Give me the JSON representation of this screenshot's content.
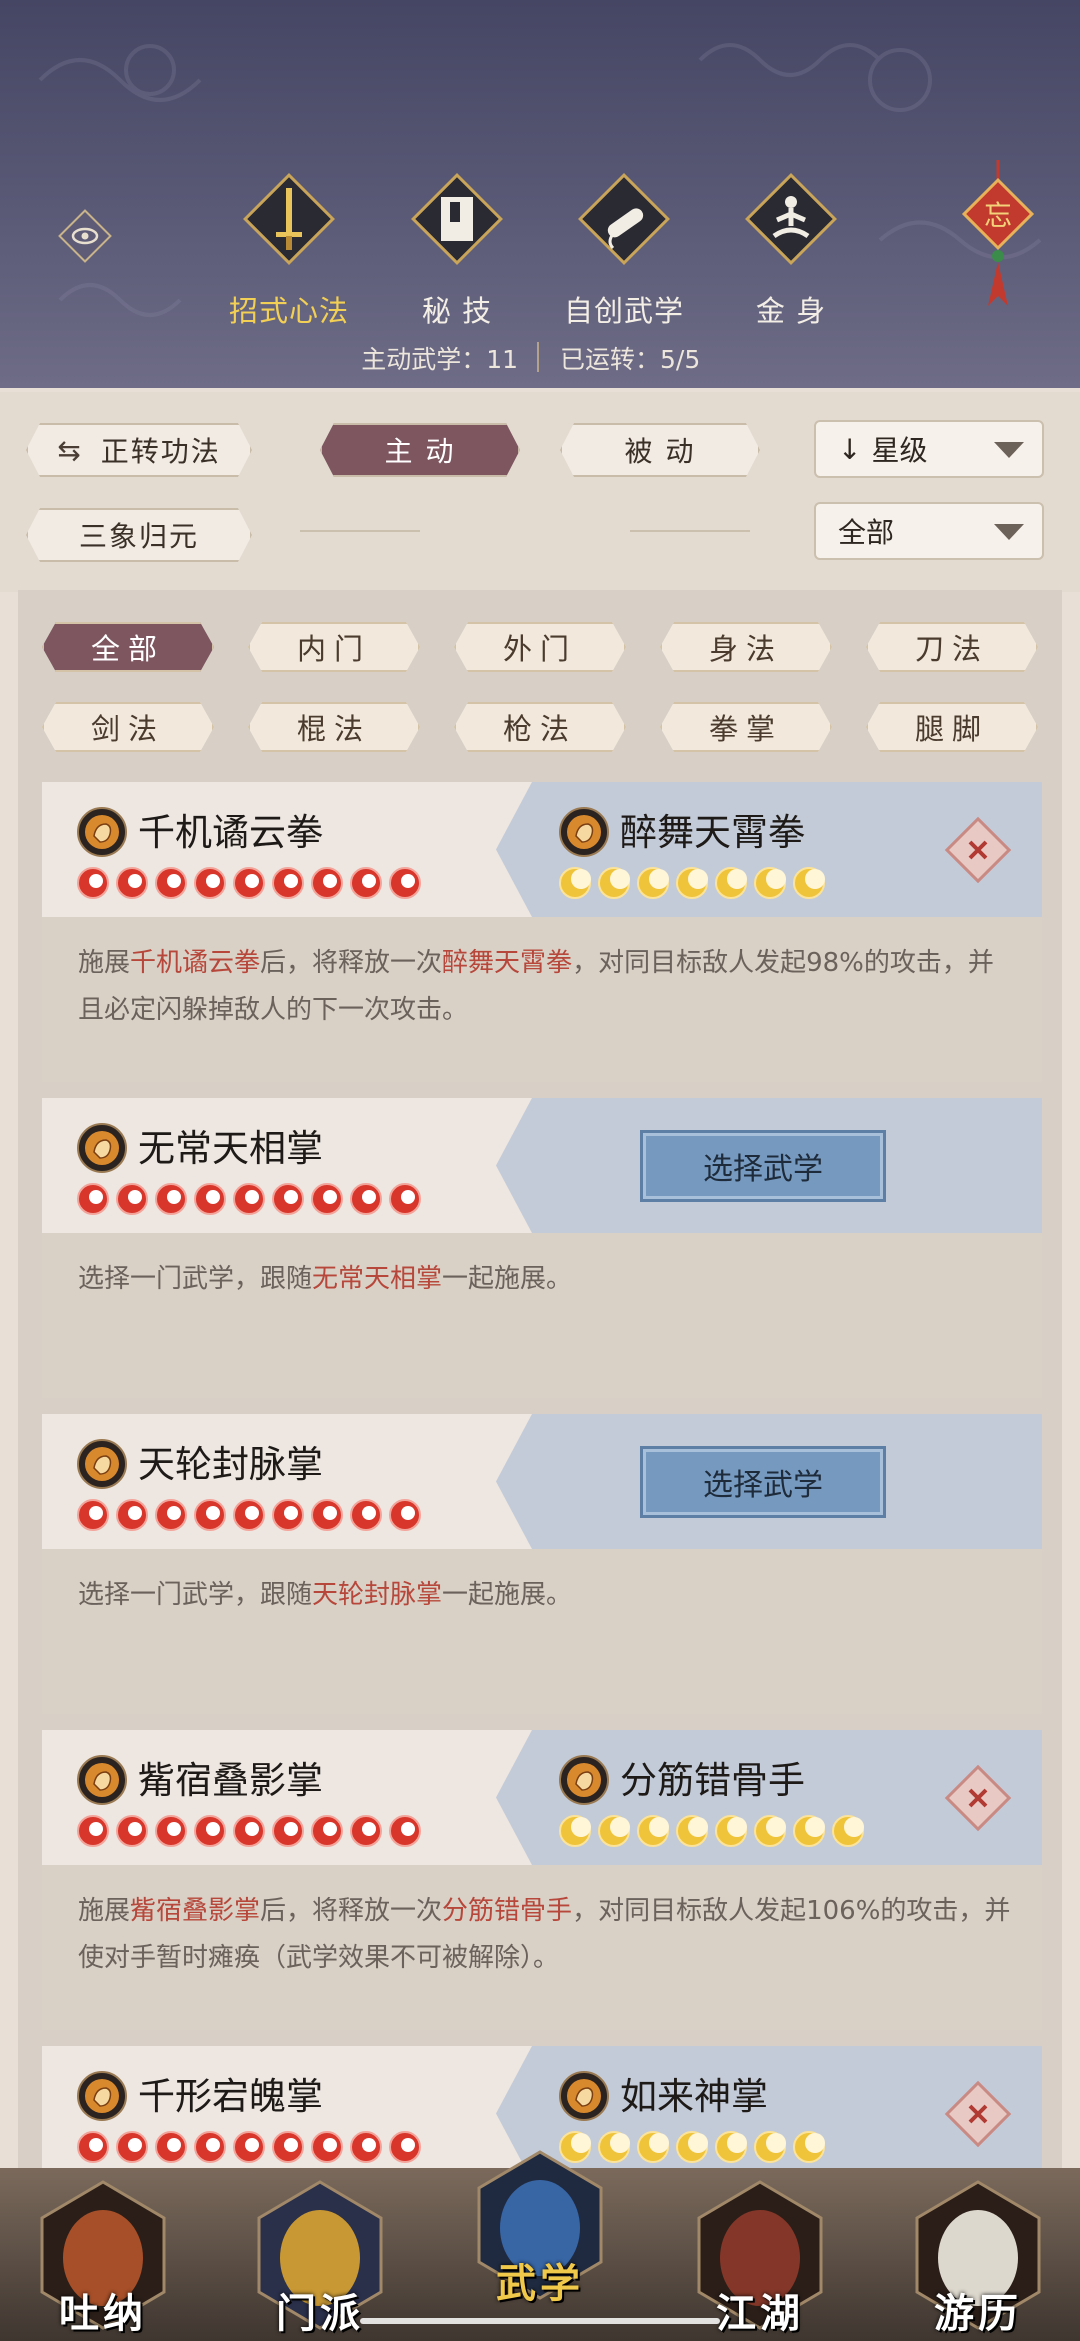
{
  "header": {
    "tabs": [
      {
        "label": "招式心法",
        "icon": "sword-icon",
        "active": true
      },
      {
        "label": "秘 技",
        "icon": "book-icon",
        "active": false
      },
      {
        "label": "自创武学",
        "icon": "scroll-icon",
        "active": false
      },
      {
        "label": "金 身",
        "icon": "meditation-icon",
        "active": false
      }
    ],
    "knot_char": "忘",
    "stats": {
      "active_skills": "主动武学：11",
      "running": "已运转：5/5"
    }
  },
  "controls": {
    "switch_label": "正转功法",
    "tab_active": "主 动",
    "tab_passive": "被 动",
    "sort_select": "星级",
    "sanxiang_label": "三象归元",
    "filter_select": "全部"
  },
  "filters": [
    "全部",
    "内门",
    "外门",
    "身法",
    "刀法",
    "剑法",
    "棍法",
    "枪法",
    "拳掌",
    "腿脚"
  ],
  "active_filter": 0,
  "cards": [
    {
      "left": {
        "name": "千机谲云拳",
        "stars": 9,
        "star_color": "red"
      },
      "right": {
        "name": "醉舞天霄拳",
        "stars": 7,
        "star_color": "gold"
      },
      "has_partner": true,
      "desc_parts": [
        "施展",
        "千机谲云拳",
        "后，将释放一次",
        "醉舞天霄拳",
        "，对同目标敌人发起98%的攻击，并且必定闪躲掉敌人的下一次攻击。"
      ]
    },
    {
      "left": {
        "name": "无常天相掌",
        "stars": 9,
        "star_color": "red"
      },
      "has_partner": false,
      "choose_label": "选择武学",
      "desc_parts": [
        "选择一门武学，跟随",
        "无常天相掌",
        "一起施展。"
      ]
    },
    {
      "left": {
        "name": "天轮封脉掌",
        "stars": 9,
        "star_color": "red"
      },
      "has_partner": false,
      "choose_label": "选择武学",
      "desc_parts": [
        "选择一门武学，跟随",
        "天轮封脉掌",
        "一起施展。"
      ]
    },
    {
      "left": {
        "name": "觜宿叠影掌",
        "stars": 9,
        "star_color": "red"
      },
      "right": {
        "name": "分筋错骨手",
        "stars": 8,
        "star_color": "gold"
      },
      "has_partner": true,
      "desc_parts": [
        "施展",
        "觜宿叠影掌",
        "后，将释放一次",
        "分筋错骨手",
        "，对同目标敌人发起106%的攻击，并使对手暂时瘫痪（武学效果不可被解除）。"
      ]
    },
    {
      "left": {
        "name": "千形宕魄掌",
        "stars": 9,
        "star_color": "red"
      },
      "right": {
        "name": "如来神掌",
        "stars": 7,
        "star_color": "gold"
      },
      "has_partner": true,
      "desc_parts": [
        "",
        "",
        "",
        "",
        ""
      ]
    }
  ],
  "bottom_nav": [
    {
      "label": "吐纳",
      "icon": "monk-icon",
      "active": false
    },
    {
      "label": "门派",
      "icon": "banner-icon",
      "active": false
    },
    {
      "label": "武学",
      "icon": "manual-icon",
      "active": true
    },
    {
      "label": "江湖",
      "icon": "straw-hat-icon",
      "active": false
    },
    {
      "label": "游历",
      "icon": "horse-icon",
      "active": false
    }
  ],
  "colors": {
    "accent": "#7d5660",
    "highlight": "#b6473a",
    "header_bg": "#4c4c69",
    "choose_button": "#7699c0"
  }
}
